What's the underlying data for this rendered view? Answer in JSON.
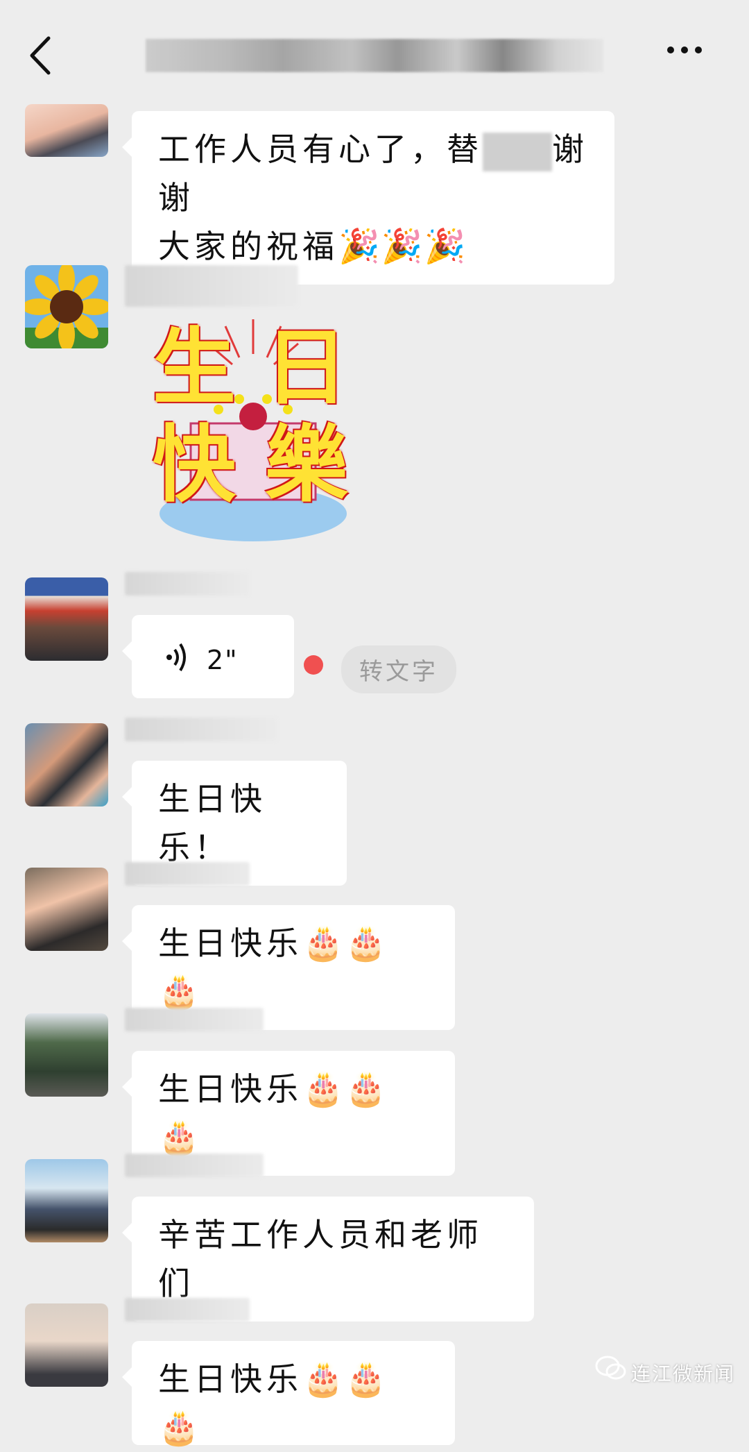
{
  "header": {
    "back_icon": "chevron-left-icon",
    "more_icon": "more-dots-icon"
  },
  "messages": [
    {
      "type": "text",
      "text_a": "工作人员有心了，替",
      "text_b": "谢谢",
      "text_c": "大家的祝福",
      "emoji": "🎉🎉🎉"
    },
    {
      "type": "sticker",
      "sticker_lines": [
        "生 日",
        "快 樂"
      ]
    },
    {
      "type": "voice",
      "duration": "2\"",
      "convert_label": "转文字"
    },
    {
      "type": "text",
      "text": "生日快乐！"
    },
    {
      "type": "text",
      "text": "生日快乐",
      "emoji": "🎂🎂🎂"
    },
    {
      "type": "text",
      "text": "生日快乐",
      "emoji": "🎂🎂🎂"
    },
    {
      "type": "text",
      "text": "辛苦工作人员和老师们"
    },
    {
      "type": "text",
      "text": "生日快乐",
      "emoji": "🎂🎂🎂"
    }
  ],
  "watermark": {
    "text": "连江微新闻"
  },
  "colors": {
    "background": "#ededed",
    "bubble": "#ffffff",
    "unread_dot": "#f05050"
  }
}
